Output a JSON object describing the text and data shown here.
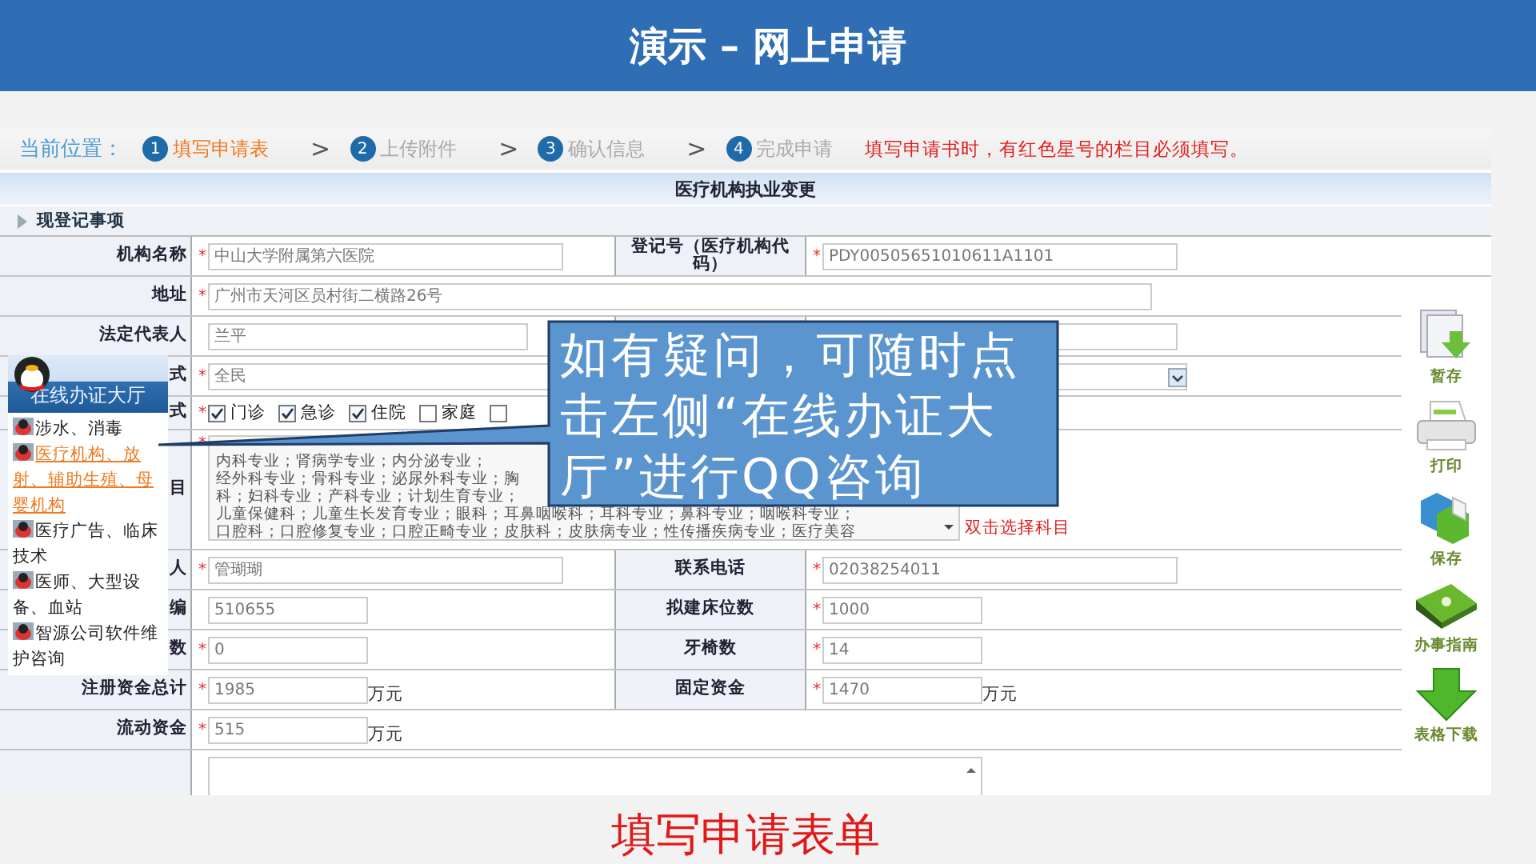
{
  "slide": {
    "title": "演示 – 网上申请",
    "caption": "填写申请表单"
  },
  "breadcrumb": {
    "label": "当前位置：",
    "steps": [
      {
        "num": "1",
        "label": "填写申请表",
        "selected": true
      },
      {
        "sep": ">",
        "num": "2",
        "label": "上传附件",
        "selected": false
      },
      {
        "sep": ">",
        "num": "3",
        "label": "确认信息",
        "selected": false
      },
      {
        "sep": ">",
        "num": "4",
        "label": "完成申请",
        "selected": false
      }
    ],
    "note": "填写申请书时，有红色星号的栏目必须填写。"
  },
  "form": {
    "title": "医疗机构执业变更",
    "section": "现登记事项",
    "rows": [
      {
        "kind": "fields",
        "label": "机构名称",
        "fields": [
          {
            "kind": "medium",
            "mark": "*",
            "value": "中山大学附属第六医院"
          }
        ],
        "label2": "登记号（医疗机构代码）",
        "fields2": [
          {
            "kind": "medium",
            "mark": "*",
            "value": "PDY00505651010611A1101"
          }
        ]
      },
      {
        "kind": "fields",
        "label": "地址",
        "fields": [
          {
            "kind": "long",
            "mark": "*",
            "value": "广州市天河区员村街二横路26号"
          }
        ]
      },
      {
        "kind": "fields",
        "label": "法定代表人",
        "fields": [
          {
            "kind": "narrow",
            "value": "兰平"
          }
        ],
        "fields2": [
          {
            "kind": "medium"
          }
        ]
      },
      {
        "kind": "fields",
        "label": "式",
        "fields": [
          {
            "kind": "select",
            "mark": "*",
            "value": "全民"
          }
        ]
      },
      {
        "kind": "checks",
        "label": "式",
        "mark": "*",
        "checks": [
          {
            "label": "门诊",
            "checked": true
          },
          {
            "label": "急诊",
            "checked": true
          },
          {
            "label": "住院",
            "checked": true
          },
          {
            "label": "家庭",
            "checked": false
          },
          {
            "checked": false
          }
        ]
      },
      {
        "kind": "subjects",
        "label": "目",
        "mark": "*",
        "lines": [
          "内科专业；肾病学专业；内分泌专业；",
          "经外科专业；骨科专业；泌尿外科专业；胸",
          "科；妇科专业；产科专业；计划生育专业；",
          "儿童保健科；儿童生长发育专业；眼科；耳鼻咽喉科；耳科专业；鼻科专业；咽喉科专业；",
          "口腔科；口腔修复专业；口腔正畸专业；皮肤科；皮肤病专业；性传播疾病专业；医疗美容"
        ],
        "hint": "双击选择科目"
      },
      {
        "kind": "fields",
        "label": "人",
        "fields": [
          {
            "kind": "medium",
            "mark": "*",
            "value": "管瑚瑚"
          }
        ],
        "label2": "联系电话",
        "fields2": [
          {
            "kind": "medium",
            "mark": "*",
            "value": "02038254011"
          }
        ]
      },
      {
        "kind": "fields",
        "label": "编",
        "fields": [
          {
            "kind": "short",
            "value": "510655"
          }
        ],
        "label2": "拟建床位数",
        "fields2": [
          {
            "kind": "short",
            "mark": "*",
            "value": "1000"
          }
        ]
      },
      {
        "kind": "fields",
        "label": "数",
        "fields": [
          {
            "kind": "short",
            "mark": "*",
            "value": "0"
          }
        ],
        "label2": "牙椅数",
        "fields2": [
          {
            "kind": "short",
            "mark": "*",
            "value": "14"
          }
        ]
      },
      {
        "kind": "fields",
        "label": "注册资金总计",
        "fields": [
          {
            "kind": "short",
            "mark": "*",
            "value": "1985",
            "unit": "万元"
          }
        ],
        "label2": "固定资金",
        "fields2": [
          {
            "kind": "short",
            "mark": "*",
            "value": "1470",
            "unit": "万元"
          }
        ]
      },
      {
        "kind": "fields",
        "label": "流动资金",
        "fields": [
          {
            "kind": "short",
            "mark": "*",
            "value": "515",
            "unit": "万元"
          }
        ]
      },
      {
        "kind": "memo"
      }
    ]
  },
  "tools": [
    {
      "kind": "draft",
      "label": "暂存"
    },
    {
      "kind": "print",
      "label": "打印"
    },
    {
      "kind": "save",
      "label": "保存"
    },
    {
      "kind": "guide",
      "label": "办事指南"
    },
    {
      "kind": "download",
      "label": "表格下载"
    }
  ],
  "qq_panel": {
    "title": "在线办证大厅",
    "items": [
      {
        "label": "涉水、消毒",
        "selected": false
      },
      {
        "label": "医疗机构、放射、辅助生殖、母婴机构",
        "selected": true
      },
      {
        "label": "医疗广告、临床技术",
        "selected": false
      },
      {
        "label": "医师、大型设备、血站",
        "selected": false
      },
      {
        "label": "智源公司软件维护咨询",
        "selected": false
      }
    ]
  },
  "callout": {
    "text": "如有疑问，可随时点击左侧“在线办证大厅”进行QQ咨询"
  }
}
